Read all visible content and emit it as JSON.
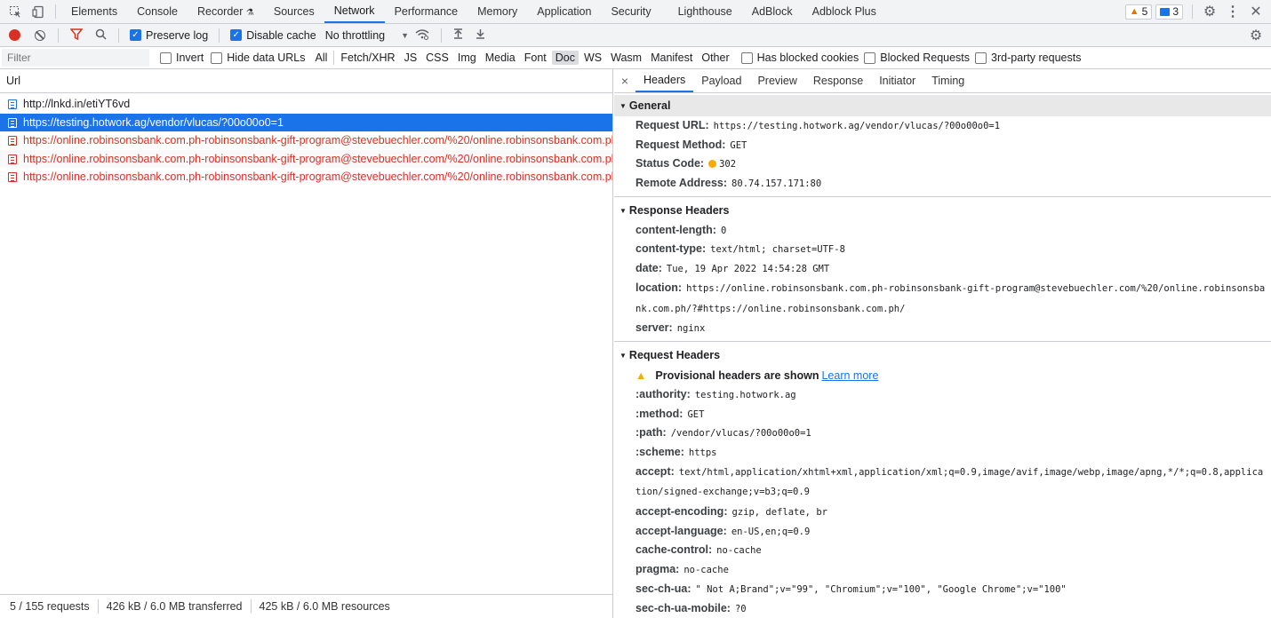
{
  "topbar": {
    "tabs": [
      "Elements",
      "Console",
      "Recorder",
      "Sources",
      "Network",
      "Performance",
      "Memory",
      "Application",
      "Security",
      "Lighthouse",
      "AdBlock",
      "Adblock Plus"
    ],
    "active_tab": "Network",
    "warnings_count": "5",
    "messages_count": "3"
  },
  "toolbar": {
    "preserve_log": "Preserve log",
    "disable_cache": "Disable cache",
    "throttling": "No throttling"
  },
  "filterbar": {
    "placeholder": "Filter",
    "invert": "Invert",
    "hide_data_urls": "Hide data URLs",
    "types": [
      "All",
      "Fetch/XHR",
      "JS",
      "CSS",
      "Img",
      "Media",
      "Font",
      "Doc",
      "WS",
      "Wasm",
      "Manifest",
      "Other"
    ],
    "selected_type": "Doc",
    "has_blocked_cookies": "Has blocked cookies",
    "blocked_requests": "Blocked Requests",
    "third_party": "3rd-party requests"
  },
  "requests": {
    "column_header": "Url",
    "rows": [
      "http://lnkd.in/etiYT6vd",
      "https://testing.hotwork.ag/vendor/vlucas/?00o00o0=1",
      "https://online.robinsonsbank.com.ph-robinsonsbank-gift-program@stevebuechler.com/%20/online.robinsonsbank.com.ph/?",
      "https://online.robinsonsbank.com.ph-robinsonsbank-gift-program@stevebuechler.com/%20/online.robinsonsbank.com.ph/?",
      "https://online.robinsonsbank.com.ph-robinsonsbank-gift-program@stevebuechler.com/%20/online.robinsonsbank.com.ph/?"
    ]
  },
  "statusbar": {
    "requests": "5 / 155 requests",
    "transferred": "426 kB / 6.0 MB transferred",
    "resources": "425 kB / 6.0 MB resources"
  },
  "details": {
    "tabs": [
      "Headers",
      "Payload",
      "Preview",
      "Response",
      "Initiator",
      "Timing"
    ],
    "active_tab": "Headers",
    "general": {
      "title": "General",
      "request_url_key": "Request URL:",
      "request_url": "https://testing.hotwork.ag/vendor/vlucas/?00o00o0=1",
      "request_method_key": "Request Method:",
      "request_method": "GET",
      "status_code_key": "Status Code:",
      "status_code": "302",
      "remote_address_key": "Remote Address:",
      "remote_address": "80.74.157.171:80"
    },
    "response_headers": {
      "title": "Response Headers",
      "content_length_key": "content-length:",
      "content_length": "0",
      "content_type_key": "content-type:",
      "content_type": "text/html; charset=UTF-8",
      "date_key": "date:",
      "date": "Tue, 19 Apr 2022 14:54:28 GMT",
      "location_key": "location:",
      "location": "https://online.robinsonsbank.com.ph-robinsonsbank-gift-program@stevebuechler.com/%20/online.robinsonsbank.com.ph/?#https://online.robinsonsbank.com.ph/",
      "server_key": "server:",
      "server": "nginx"
    },
    "request_headers": {
      "title": "Request Headers",
      "provisional": "Provisional headers are shown",
      "learn_more": "Learn more",
      "authority_key": ":authority:",
      "authority": "testing.hotwork.ag",
      "method_key": ":method:",
      "method": "GET",
      "path_key": ":path:",
      "path": "/vendor/vlucas/?00o00o0=1",
      "scheme_key": ":scheme:",
      "scheme": "https",
      "accept_key": "accept:",
      "accept": "text/html,application/xhtml+xml,application/xml;q=0.9,image/avif,image/webp,image/apng,*/*;q=0.8,application/signed-exchange;v=b3;q=0.9",
      "accept_encoding_key": "accept-encoding:",
      "accept_encoding": "gzip, deflate, br",
      "accept_language_key": "accept-language:",
      "accept_language": "en-US,en;q=0.9",
      "cache_control_key": "cache-control:",
      "cache_control": "no-cache",
      "pragma_key": "pragma:",
      "pragma": "no-cache",
      "sec_ch_ua_key": "sec-ch-ua:",
      "sec_ch_ua": "\" Not A;Brand\";v=\"99\", \"Chromium\";v=\"100\", \"Google Chrome\";v=\"100\"",
      "sec_ch_ua_mobile_key": "sec-ch-ua-mobile:",
      "sec_ch_ua_mobile": "?0"
    }
  }
}
